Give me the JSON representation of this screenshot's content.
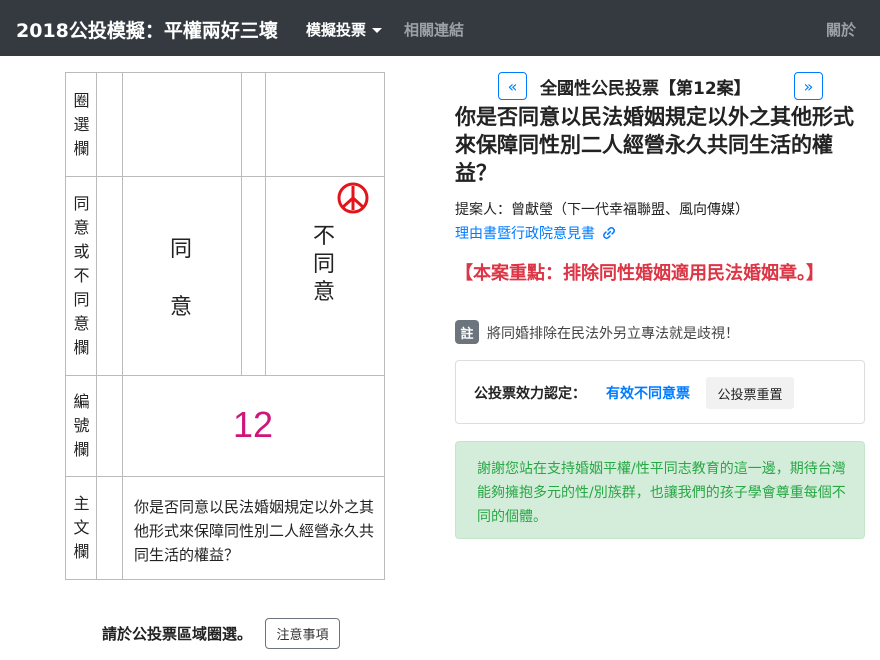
{
  "navbar": {
    "brand": "2018公投模擬：平權兩好三壞",
    "dropdown_label": "模擬投票",
    "links_label": "相關連結",
    "about_label": "關於"
  },
  "ballot": {
    "labels": {
      "circle_col": "圈選欄",
      "agree_col": "同意或不同意欄",
      "number_col": "編號欄",
      "main_col": "主文欄"
    },
    "agree": "同意",
    "disagree": "不同意",
    "stamp_icon": "vote-stamp-icon",
    "stamp_color": "#e4141b",
    "number": "12",
    "number_color": "#d0157a",
    "main_text": "你是否同意以民法婚姻規定以外之其他形式來保障同性別二人經營永久共同生活的權益？"
  },
  "footer": {
    "instruction": "請於公投票區域圈選。",
    "notice_button": "注意事項"
  },
  "case": {
    "prev_label": "«",
    "next_label": "»",
    "title": "全國性公民投票【第12案】",
    "question": "你是否同意以民法婚姻規定以外之其他形式來保障同性別二人經營永久共同生活的權益？",
    "proposer": "提案人：曾獻瑩（下一代幸福聯盟、風向傳媒）",
    "reason_link": "理由書暨行政院意見書",
    "link_icon": "link-icon",
    "highlight": "【本案重點：排除同性婚姻適用民法婚姻章。】",
    "note_badge": "註",
    "note_text": "將同婚排除在民法外另立專法就是歧視！"
  },
  "validity": {
    "label": "公投票效力認定：",
    "status": "有效不同意票",
    "reset_button": "公投票重置"
  },
  "alert": {
    "text": "謝謝您站在支持婚姻平權/性平同志教育的這一邊，期待台灣能夠擁抱多元的性/別族群，也讓我們的孩子學會尊重每個不同的個體。"
  },
  "colors": {
    "navbar_bg": "#343a40",
    "link_blue": "#007bff",
    "danger_red": "#dc3545",
    "success_green": "#28a745",
    "alert_bg": "#d4edda"
  }
}
